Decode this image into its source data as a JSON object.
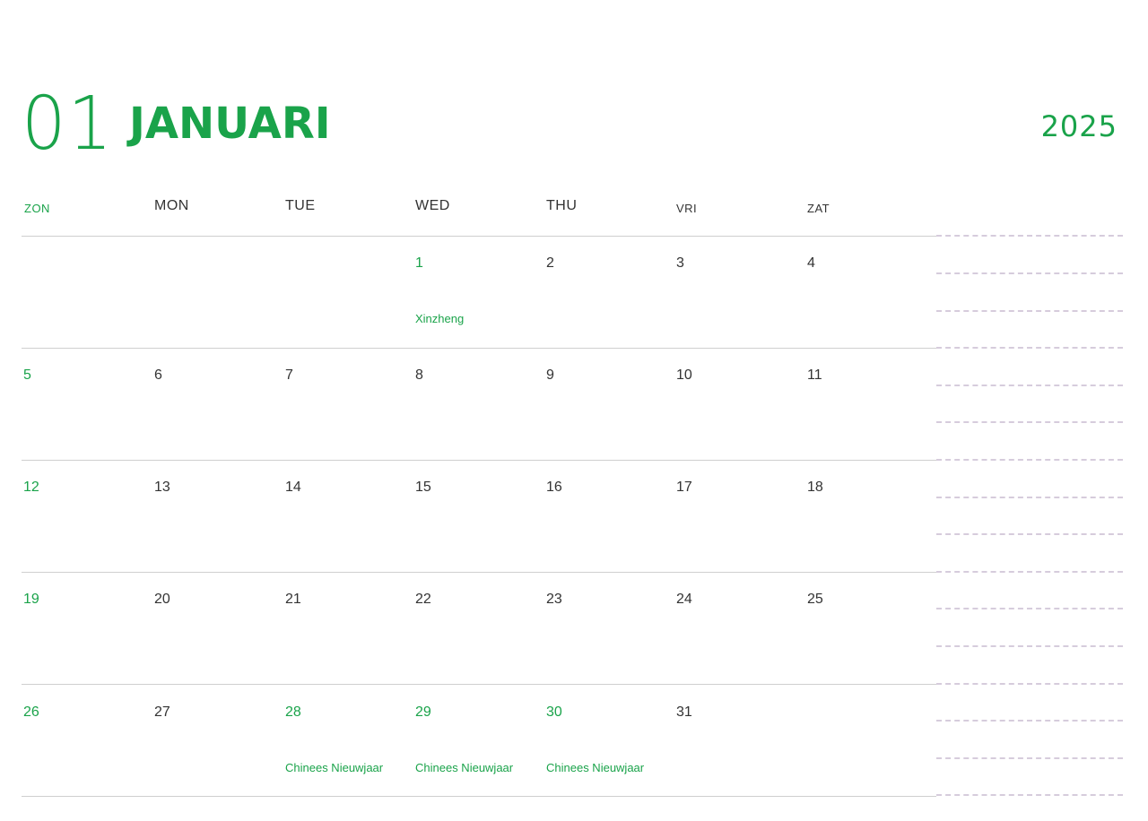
{
  "header": {
    "month_number": "01",
    "month_name": "JANUARI",
    "year": "2025"
  },
  "weekdays": [
    {
      "label": "ZON"
    },
    {
      "label": "MON"
    },
    {
      "label": "TUE"
    },
    {
      "label": "WED"
    },
    {
      "label": "THU"
    },
    {
      "label": "VRI"
    },
    {
      "label": "ZAT"
    }
  ],
  "weeks": [
    {
      "days": [
        "",
        "",
        "",
        "1",
        "2",
        "3",
        "4"
      ]
    },
    {
      "days": [
        "5",
        "6",
        "7",
        "8",
        "9",
        "10",
        "11"
      ]
    },
    {
      "days": [
        "12",
        "13",
        "14",
        "15",
        "16",
        "17",
        "18"
      ]
    },
    {
      "days": [
        "19",
        "20",
        "21",
        "22",
        "23",
        "24",
        "25"
      ]
    },
    {
      "days": [
        "26",
        "27",
        "28",
        "29",
        "30",
        "31",
        ""
      ]
    }
  ],
  "events": [
    {
      "date": "1",
      "label": "Xinzheng"
    },
    {
      "date": "28",
      "label": "Chinees Nieuwjaar"
    },
    {
      "date": "29",
      "label": "Chinees Nieuwjaar"
    },
    {
      "date": "30",
      "label": "Chinees Nieuwjaar"
    }
  ],
  "colors": {
    "accent": "#1aa34a",
    "text": "#333333",
    "grid_line": "#cfcfcf",
    "notes_dash": "#d6ccdc"
  }
}
